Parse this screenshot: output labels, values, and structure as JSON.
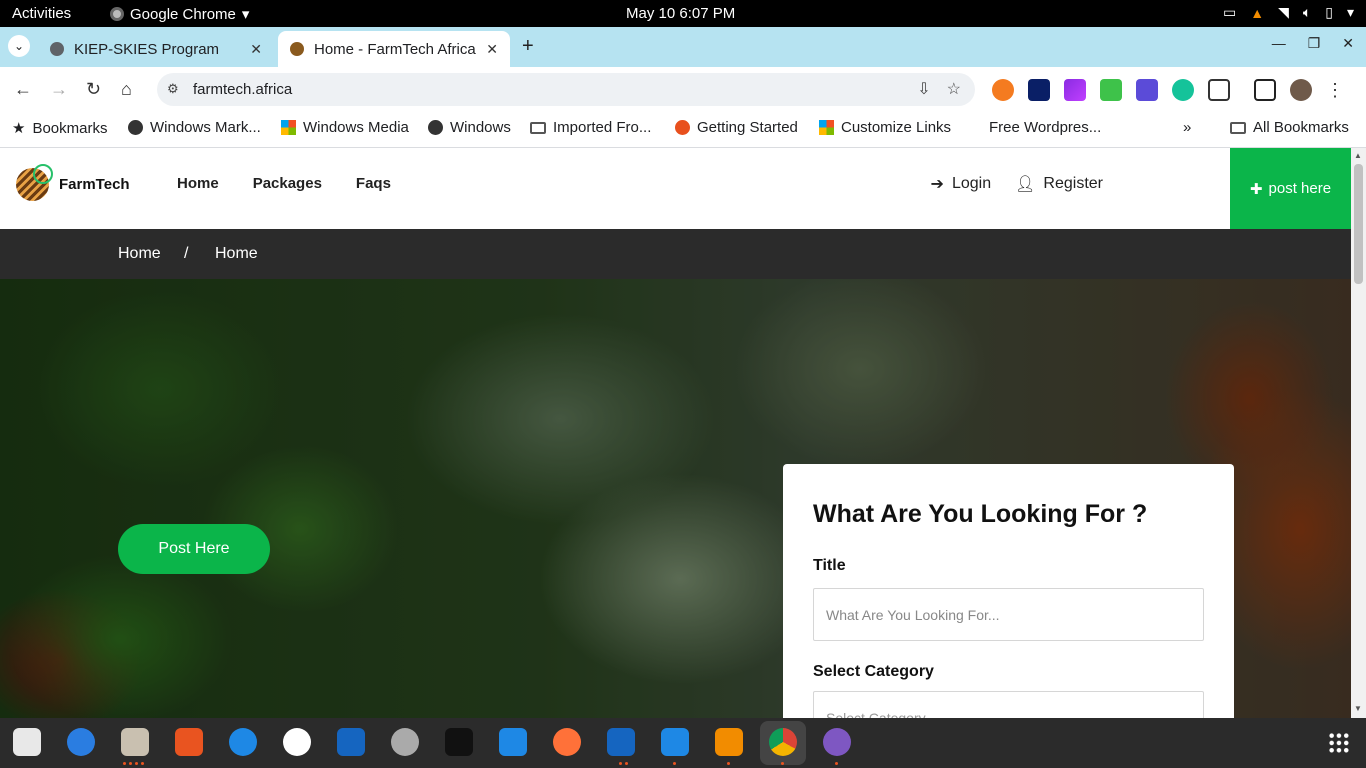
{
  "system": {
    "activities": "Activities",
    "app_name": "Google Chrome",
    "clock": "May 10   6:07 PM"
  },
  "tabs": [
    {
      "title": "KIEP-SKIES Program",
      "active": false
    },
    {
      "title": "Home - FarmTech Africa",
      "active": true
    }
  ],
  "toolbar": {
    "url": "farmtech.africa"
  },
  "bookmarks": {
    "items": [
      {
        "label": "Bookmarks",
        "icon": "star-icon"
      },
      {
        "label": "Windows Mark...",
        "icon": "globe-icon"
      },
      {
        "label": "Windows Media",
        "icon": "windows-icon"
      },
      {
        "label": "Windows",
        "icon": "globe-icon"
      },
      {
        "label": "Imported Fro...",
        "icon": "folder-icon"
      },
      {
        "label": "Getting Started",
        "icon": "firefox-icon"
      },
      {
        "label": "Customize Links",
        "icon": "windows-icon"
      },
      {
        "label": "Free Wordpres...",
        "icon": "none"
      }
    ],
    "overflow": "»",
    "all": "All Bookmarks"
  },
  "site": {
    "brand": "FarmTech",
    "nav": [
      "Home",
      "Packages",
      "Faqs"
    ],
    "login": "Login",
    "register": "Register",
    "post_cta": "post here",
    "breadcrumb": [
      "Home",
      "/",
      "Home"
    ],
    "hero_button": "Post Here",
    "search": {
      "heading": "What Are You Looking For ?",
      "title_label": "Title",
      "title_placeholder": "What Are You Looking For...",
      "category_label": "Select Category",
      "category_placeholder": "Select Category"
    }
  },
  "colors": {
    "accent_green": "#0bb54a",
    "breadcrumb_bg": "#2b2b2b",
    "tabstrip_bg": "#b6e3f1"
  }
}
